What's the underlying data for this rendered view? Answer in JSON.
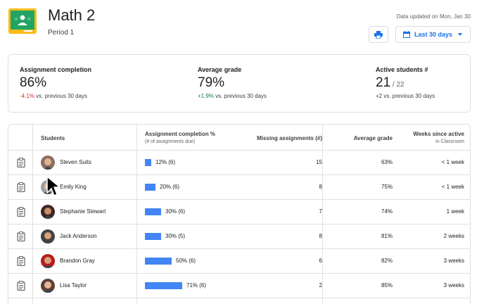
{
  "header": {
    "class_title": "Math 2",
    "class_subtitle": "Period 1",
    "updated_text": "Data updated on Mon, Jan 30",
    "range_label": "Last 30 days",
    "brand_color": "#1a73e8"
  },
  "stats": [
    {
      "label": "Assignment completion",
      "value": "86%",
      "value_suffix": "",
      "delta": "-4.1%",
      "delta_suffix": " vs. previous 30 days",
      "delta_tone": "negative"
    },
    {
      "label": "Average grade",
      "value": "79%",
      "value_suffix": "",
      "delta": "+1.9%",
      "delta_suffix": " vs. previous 30 days",
      "delta_tone": "positive"
    },
    {
      "label": "Active students  #",
      "value": "21",
      "value_suffix": " / 22",
      "delta": "",
      "delta_suffix": "+2 vs. previous 30 days",
      "delta_tone": "neutral"
    }
  ],
  "table": {
    "headers": {
      "students": "Students",
      "completion": "Assignment completion %",
      "completion_sub": "(# of assignments due)",
      "missing": "Missing assignments (#)",
      "average": "Average grade",
      "weeks": "Weeks since active",
      "weeks_sub": "in Classroom"
    },
    "rows": [
      {
        "name": "Steven Suits",
        "completion_pct": 12,
        "completion_label": "12% (6)",
        "missing": "15",
        "average": "63%",
        "weeks": "< 1 week",
        "avatar_bg": "#8d6e63",
        "avatar_skin": "#e0b48c"
      },
      {
        "name": "Emily King",
        "completion_pct": 20,
        "completion_label": "20% (6)",
        "missing": "8",
        "average": "75%",
        "weeks": "< 1 week",
        "avatar_bg": "#9e9e9e",
        "avatar_skin": "#e8c3a0"
      },
      {
        "name": "Stephanie Stewart",
        "completion_pct": 30,
        "completion_label": "30% (6)",
        "missing": "7",
        "average": "74%",
        "weeks": "1 week",
        "avatar_bg": "#3e2723",
        "avatar_skin": "#c68e6b"
      },
      {
        "name": "Jack Anderson",
        "completion_pct": 30,
        "completion_label": "30% (5)",
        "missing": "8",
        "average": "81%",
        "weeks": "2 weeks",
        "avatar_bg": "#424242",
        "avatar_skin": "#d7a27c"
      },
      {
        "name": "Brandon Gray",
        "completion_pct": 50,
        "completion_label": "50% (6)",
        "missing": "6",
        "average": "82%",
        "weeks": "3 weeks",
        "avatar_bg": "#b71c1c",
        "avatar_skin": "#d9a07a"
      },
      {
        "name": "Lisa Taylor",
        "completion_pct": 71,
        "completion_label": "71% (6)",
        "missing": "2",
        "average": "85%",
        "weeks": "3 weeks",
        "avatar_bg": "#5d4037",
        "avatar_skin": "#e6b896"
      }
    ]
  }
}
